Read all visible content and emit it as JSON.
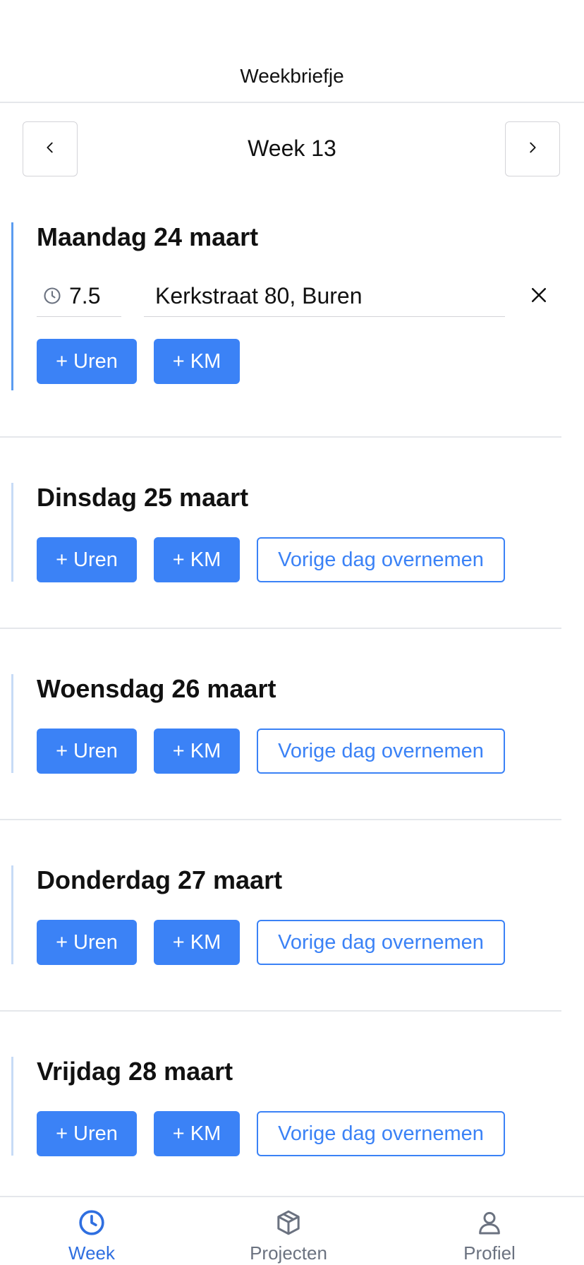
{
  "header": {
    "title": "Weekbriefje"
  },
  "week_nav": {
    "label": "Week 13",
    "prev_icon": "chevron-left-icon",
    "next_icon": "chevron-right-icon"
  },
  "days": [
    {
      "title": "Maandag 24 maart",
      "active": true,
      "entry": {
        "hours": "7.5",
        "location": "Kerkstraat 80, Buren"
      },
      "add_hours_label": "+ Uren",
      "add_km_label": "+ KM"
    },
    {
      "title": "Dinsdag 25 maart",
      "add_hours_label": "+ Uren",
      "add_km_label": "+ KM",
      "copy_prev_label": "Vorige dag overnemen"
    },
    {
      "title": "Woensdag 26 maart",
      "add_hours_label": "+ Uren",
      "add_km_label": "+ KM",
      "copy_prev_label": "Vorige dag overnemen"
    },
    {
      "title": "Donderdag 27 maart",
      "add_hours_label": "+ Uren",
      "add_km_label": "+ KM",
      "copy_prev_label": "Vorige dag overnemen"
    },
    {
      "title": "Vrijdag 28 maart",
      "add_hours_label": "+ Uren",
      "add_km_label": "+ KM",
      "copy_prev_label": "Vorige dag overnemen"
    }
  ],
  "tabbar": {
    "tabs": [
      {
        "label": "Week",
        "icon": "clock-icon",
        "active": true
      },
      {
        "label": "Projecten",
        "icon": "box-icon",
        "active": false
      },
      {
        "label": "Profiel",
        "icon": "user-icon",
        "active": false
      }
    ]
  },
  "colors": {
    "accent": "#3b82f6",
    "accent_active_bar": "#5b9cf0",
    "accent_inactive_bar": "#c7dbf6",
    "divider": "#e5e7eb"
  }
}
